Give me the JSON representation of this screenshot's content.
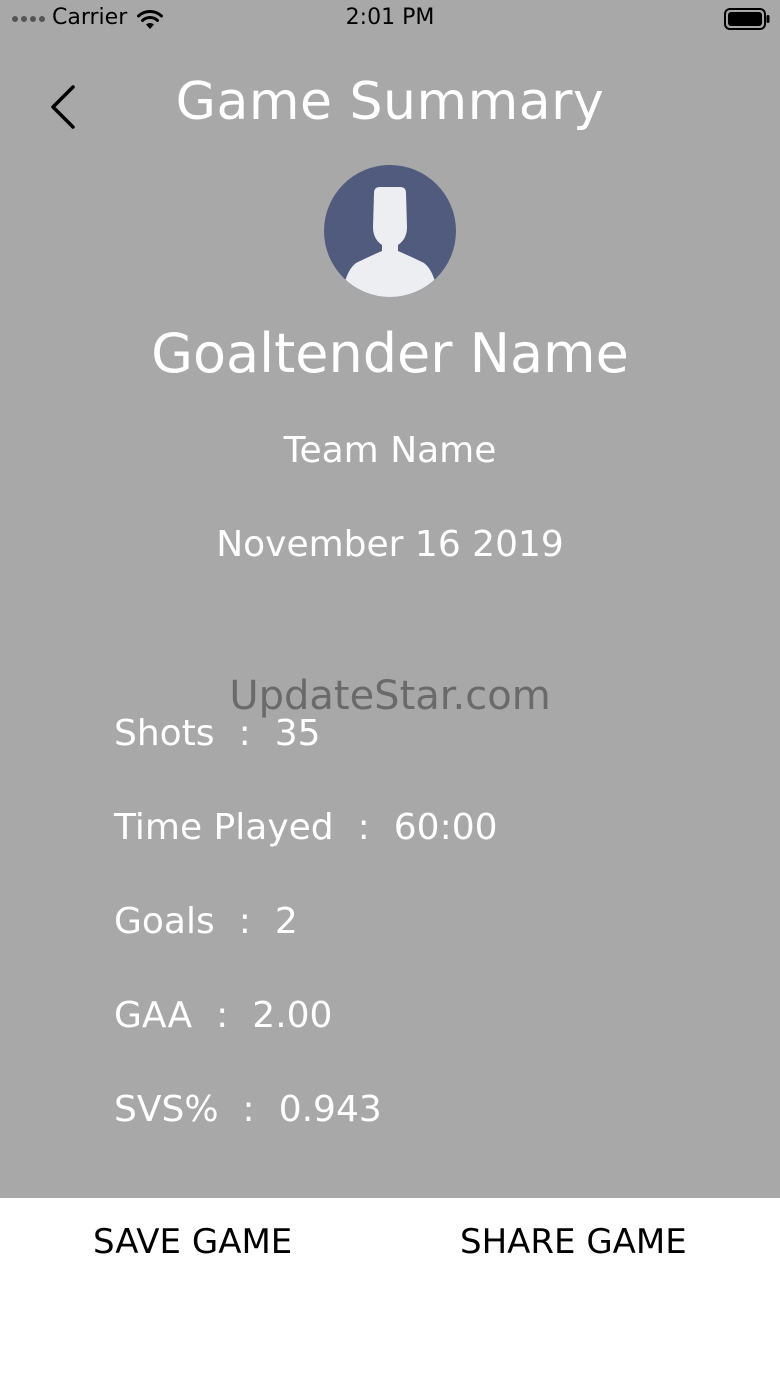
{
  "status_bar": {
    "carrier": "Carrier",
    "time": "2:01 PM"
  },
  "header": {
    "title": "Game Summary",
    "back_icon": "chevron-left-icon"
  },
  "profile": {
    "avatar_icon": "user-avatar-icon",
    "avatar_color": "#505b7e",
    "name": "Goaltender Name",
    "team": "Team Name",
    "date": "November 16 2019"
  },
  "watermark": "UpdateStar.com",
  "stats": [
    {
      "label": "Shots",
      "value": "35"
    },
    {
      "label": "Time Played",
      "value": "60:00"
    },
    {
      "label": "Goals",
      "value": "2"
    },
    {
      "label": "GAA",
      "value": "2.00"
    },
    {
      "label": "SVS%",
      "value": "0.943"
    }
  ],
  "actions": {
    "save_label": "SAVE GAME",
    "share_label": "SHARE GAME"
  },
  "colors": {
    "overlay": "#a8a8a8",
    "text": "#ffffff"
  }
}
